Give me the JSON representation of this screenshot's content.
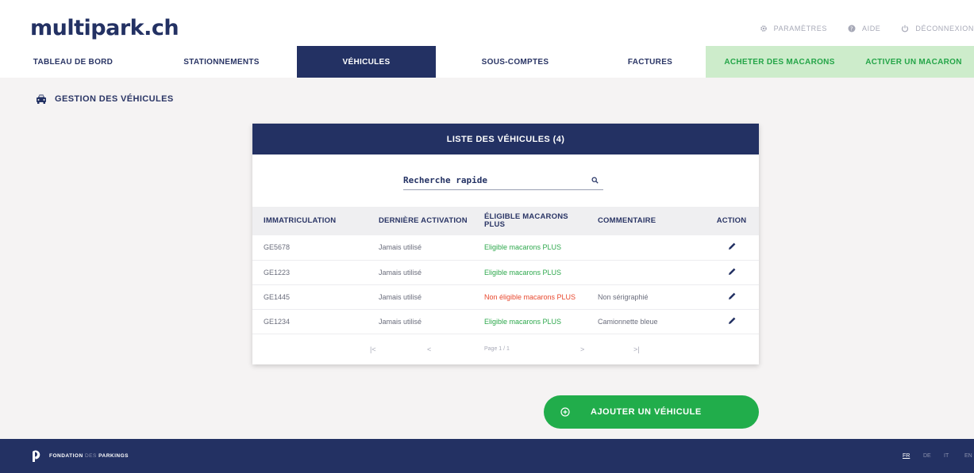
{
  "header": {
    "logo": "multipark.ch",
    "top_nav": [
      {
        "label": "PARAMÈTRES",
        "icon": "gear-icon"
      },
      {
        "label": "AIDE",
        "icon": "help-icon"
      },
      {
        "label": "DÉCONNEXION",
        "icon": "power-icon"
      }
    ],
    "main_nav": [
      {
        "label": "TABLEAU DE BORD"
      },
      {
        "label": "STATIONNEMENTS"
      },
      {
        "label": "VÉHICULES",
        "active": true
      },
      {
        "label": "SOUS-COMPTES"
      },
      {
        "label": "FACTURES"
      },
      {
        "label": "ACHETER DES MACARONS",
        "style": "green"
      },
      {
        "label": "ACTIVER UN MACARON",
        "style": "green"
      }
    ]
  },
  "page": {
    "heading": "GESTION DES VÉHICULES",
    "heading_icon": "car-icon"
  },
  "vehicles": {
    "title": "LISTE DES VÉHICULES (4)",
    "search_placeholder": "Recherche rapide",
    "columns": [
      "IMMATRICULATION",
      "DERNIÈRE ACTIVATION",
      "ÉLIGIBLE MACARONS PLUS",
      "COMMENTAIRE",
      "ACTION"
    ],
    "rows": [
      {
        "plate": "GE5678",
        "last": "Jamais utilisé",
        "eligible": "Eligible macarons PLUS",
        "status": "green",
        "comment": ""
      },
      {
        "plate": "GE1223",
        "last": "Jamais utilisé",
        "eligible": "Eligible macarons PLUS",
        "status": "green",
        "comment": ""
      },
      {
        "plate": "GE1445",
        "last": "Jamais utilisé",
        "eligible": "Non éligible macarons PLUS",
        "status": "red",
        "comment": "Non sérigraphié"
      },
      {
        "plate": "GE1234",
        "last": "Jamais utilisé",
        "eligible": "Eligible macarons PLUS",
        "status": "green",
        "comment": "Camionnette bleue"
      }
    ],
    "pager": {
      "first": "|<",
      "prev": "<",
      "page": "Page 1 / 1",
      "next": ">",
      "last": ">|"
    }
  },
  "add_button": {
    "label": "AJOUTER UN VÉHICULE",
    "icon": "plus-circle-icon"
  },
  "footer": {
    "brand_bold": "FONDATION",
    "brand_light": "DES",
    "brand_bold2": "PARKINGS",
    "languages": [
      {
        "code": "FR",
        "active": true
      },
      {
        "code": "DE"
      },
      {
        "code": "IT"
      },
      {
        "code": "EN"
      }
    ]
  },
  "colors": {
    "navy": "#233163",
    "green": "#21ad4b",
    "light_green": "#cdeccb",
    "red": "#e8482e"
  }
}
